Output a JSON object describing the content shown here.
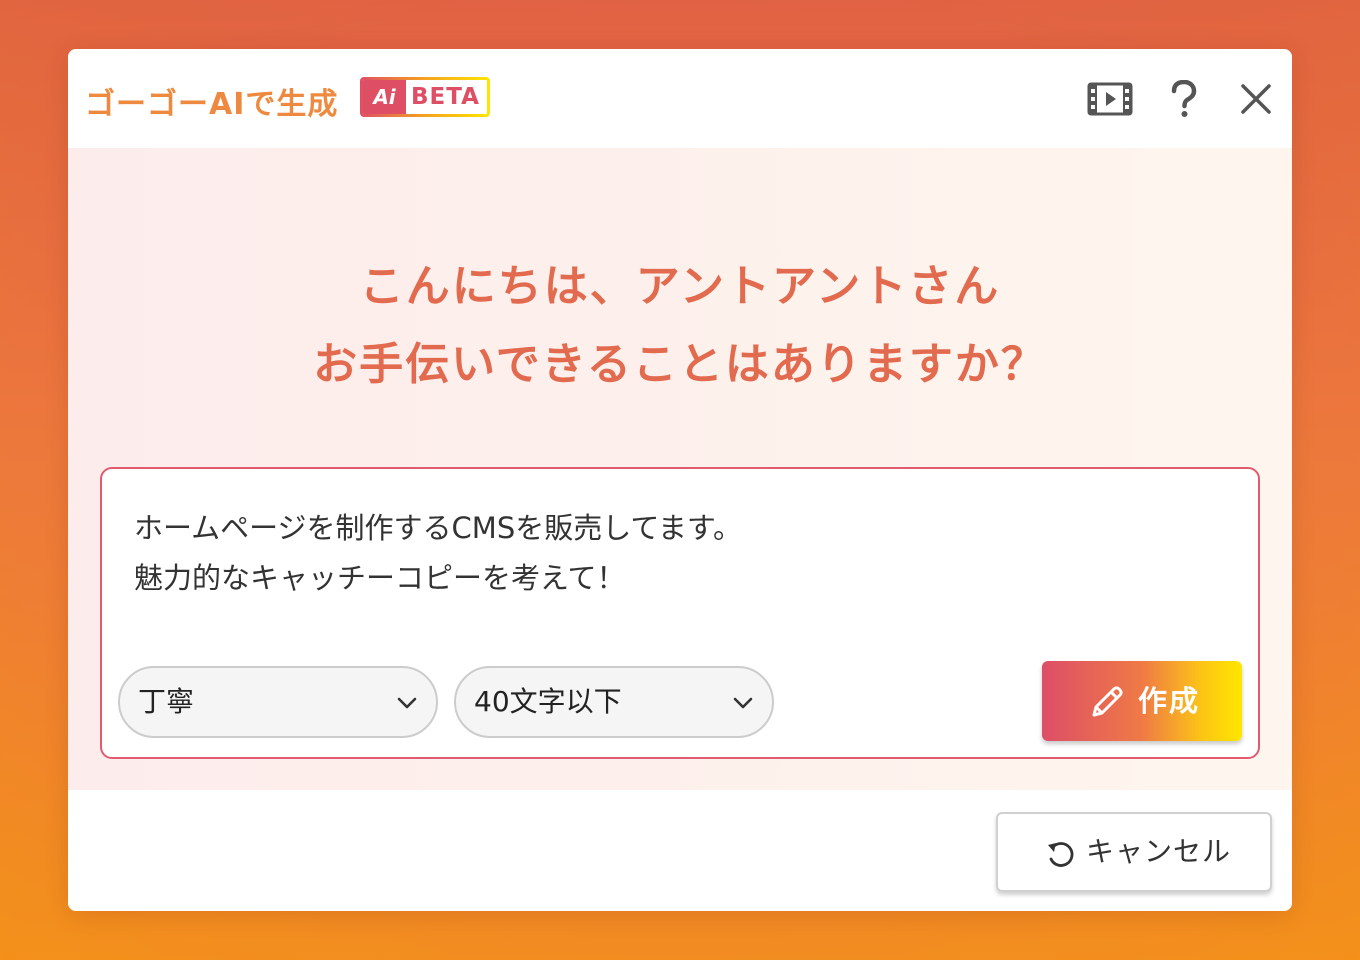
{
  "header": {
    "title": "ゴーゴーAIで生成",
    "badge": {
      "icon_text": "Ai",
      "label": "BETA"
    },
    "icons": [
      "video-icon",
      "help-icon",
      "close-icon"
    ]
  },
  "greeting": {
    "line1": "こんにちは、アントアントさん",
    "line2": "お手伝いできることはありますか？"
  },
  "prompt": {
    "text": "ホームページを制作するCMSを販売してます。\n魅力的なキャッチーコピーを考えて！"
  },
  "options": {
    "tone": {
      "selected": "丁寧"
    },
    "length": {
      "selected": "40文字以下"
    }
  },
  "actions": {
    "create_label": "作成",
    "cancel_label": "キャンセル"
  },
  "colors": {
    "title_orange": "#ee8a3f",
    "greeting": "#e26b4f",
    "accent_pink": "#de4f66",
    "accent_yellow": "#ffe600"
  }
}
